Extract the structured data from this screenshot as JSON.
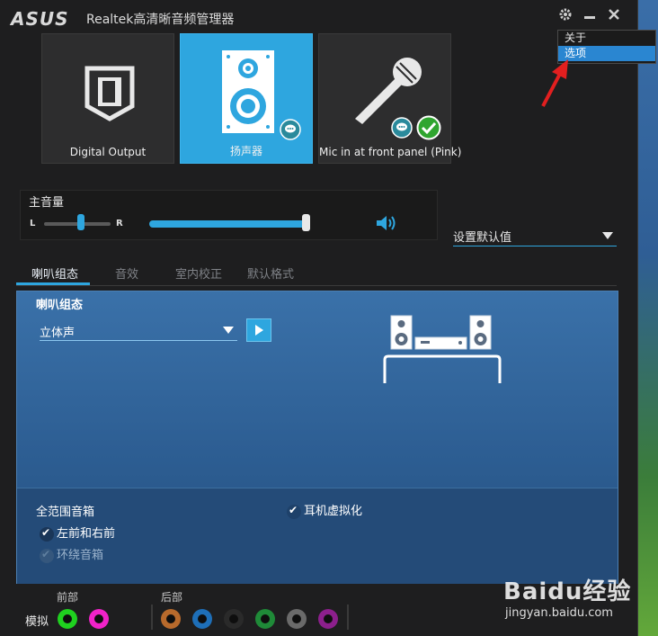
{
  "window": {
    "brand": "ASUS",
    "title": "Realtek高清晰音频管理器"
  },
  "title_buttons": {
    "settings_icon": "gear-icon",
    "minimize_icon": "minimize-icon",
    "close_icon": "close-icon"
  },
  "settings_menu": {
    "items": [
      {
        "label": "关于",
        "selected": false
      },
      {
        "label": "选项",
        "selected": true
      }
    ]
  },
  "devices": [
    {
      "label": "Digital Output",
      "active": false,
      "icon": "digital-output-icon"
    },
    {
      "label": "扬声器",
      "active": true,
      "icon": "speaker-icon"
    },
    {
      "label": "Mic in at front panel (Pink)",
      "active": false,
      "icon": "microphone-icon"
    }
  ],
  "volume": {
    "label": "主音量",
    "left": "L",
    "right": "R",
    "balance": 0.55,
    "level": 0.98
  },
  "default_device": {
    "label": "设置默认值"
  },
  "tabs": [
    {
      "label": "喇叭组态",
      "active": true
    },
    {
      "label": "音效",
      "active": false
    },
    {
      "label": "室内校正",
      "active": false
    },
    {
      "label": "默认格式",
      "active": false
    }
  ],
  "config": {
    "title": "喇叭组态",
    "selected_mode": "立体声",
    "full_range_title": "全范围音箱",
    "options": [
      {
        "label": "左前和右前",
        "checked": true,
        "enabled": true
      },
      {
        "label": "环绕音箱",
        "checked": true,
        "enabled": false
      }
    ],
    "headphone_virtualization": {
      "label": "耳机虚拟化",
      "checked": true
    }
  },
  "jacks": {
    "mode_label": "模拟",
    "front_label": "前部",
    "rear_label": "后部",
    "front_colors": [
      "#1fd11f",
      "#f022c8"
    ],
    "rear_colors": [
      "#b86a2c",
      "#1e6fb8",
      "#2a2a2a",
      "#1f8a38",
      "#6a6a6a",
      "#8c1f8c"
    ]
  },
  "watermark": {
    "text": "Baidu经验",
    "url": "jingyan.baidu.com"
  }
}
